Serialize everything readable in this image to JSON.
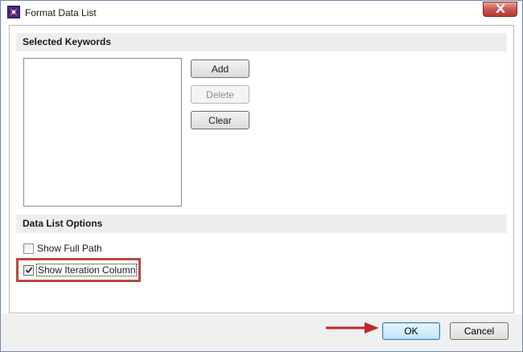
{
  "window": {
    "title": "Format Data List",
    "icons": {
      "app": "app-logo-icon",
      "close": "close-icon"
    },
    "colors": {
      "highlight": "#b84b3f",
      "arrow": "#c0282e",
      "ok_border": "#3c7fb1"
    }
  },
  "keywords_section": {
    "header": "Selected Keywords",
    "list_items": [],
    "buttons": {
      "add": "Add",
      "delete": "Delete",
      "clear": "Clear"
    },
    "delete_enabled": false
  },
  "options_section": {
    "header": "Data List Options",
    "show_full_path": {
      "label": "Show Full Path",
      "checked": false
    },
    "show_iteration_column": {
      "label": "Show Iteration Column",
      "checked": true
    }
  },
  "footer": {
    "ok": "OK",
    "cancel": "Cancel"
  }
}
